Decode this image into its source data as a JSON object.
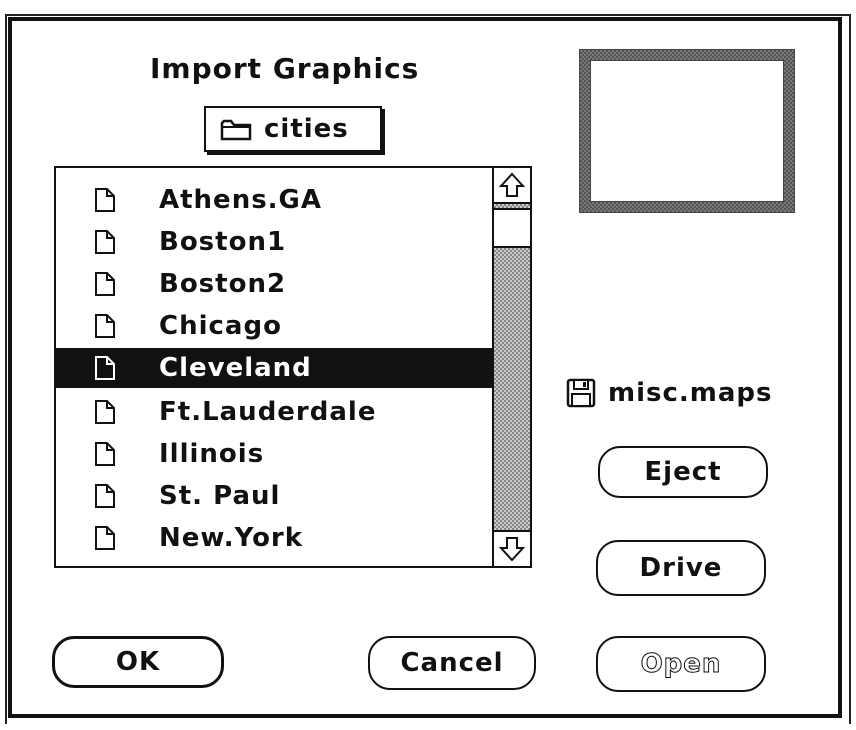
{
  "dialog": {
    "title": "Import Graphics",
    "folder": {
      "name": "cities",
      "icon": "folder-icon"
    }
  },
  "file_list": {
    "items": [
      {
        "label": "Athens.GA",
        "icon": "document-icon",
        "selected": false
      },
      {
        "label": "Boston1",
        "icon": "document-icon",
        "selected": false
      },
      {
        "label": "Boston2",
        "icon": "document-icon",
        "selected": false
      },
      {
        "label": "Chicago",
        "icon": "document-icon",
        "selected": false
      },
      {
        "label": "Cleveland",
        "icon": "document-icon",
        "selected": true
      },
      {
        "label": "Ft.Lauderdale",
        "icon": "document-icon",
        "selected": false
      },
      {
        "label": "Illinois",
        "icon": "document-icon",
        "selected": false
      },
      {
        "label": "St. Paul",
        "icon": "document-icon",
        "selected": false
      },
      {
        "label": "New.York",
        "icon": "document-icon",
        "selected": false
      }
    ],
    "scroll_position": 0.05
  },
  "disk": {
    "name": "misc.maps",
    "icon": "floppy-disk-icon"
  },
  "buttons": {
    "eject": "Eject",
    "drive": "Drive",
    "ok": "OK",
    "cancel": "Cancel",
    "open": "Open"
  },
  "colors": {
    "selection": "#111111",
    "background": "#ffffff"
  }
}
